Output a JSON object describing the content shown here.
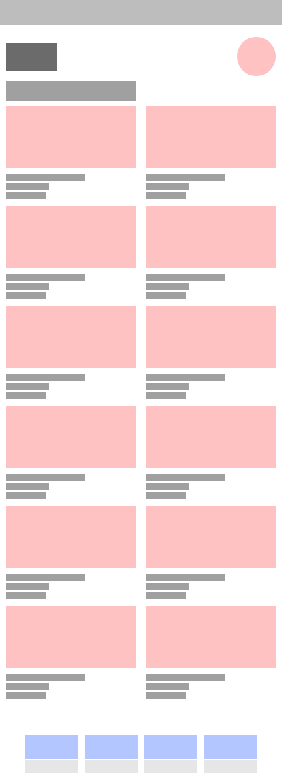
{
  "header": {
    "logo": "",
    "avatar": "",
    "section_title": ""
  },
  "cards": [
    {
      "title": "",
      "subtitle": "",
      "meta": ""
    },
    {
      "title": "",
      "subtitle": "",
      "meta": ""
    },
    {
      "title": "",
      "subtitle": "",
      "meta": ""
    },
    {
      "title": "",
      "subtitle": "",
      "meta": ""
    },
    {
      "title": "",
      "subtitle": "",
      "meta": ""
    },
    {
      "title": "",
      "subtitle": "",
      "meta": ""
    },
    {
      "title": "",
      "subtitle": "",
      "meta": ""
    },
    {
      "title": "",
      "subtitle": "",
      "meta": ""
    },
    {
      "title": "",
      "subtitle": "",
      "meta": ""
    },
    {
      "title": "",
      "subtitle": "",
      "meta": ""
    },
    {
      "title": "",
      "subtitle": "",
      "meta": ""
    },
    {
      "title": "",
      "subtitle": "",
      "meta": ""
    }
  ],
  "bottom_nav": {
    "items": [
      {
        "label": "",
        "icon": "nav-icon-1"
      },
      {
        "label": "",
        "icon": "nav-icon-2"
      },
      {
        "label": "",
        "icon": "nav-icon-3"
      },
      {
        "label": "",
        "icon": "nav-icon-4"
      }
    ]
  },
  "colors": {
    "status_bar": "#bdbdbd",
    "logo": "#6b6b6b",
    "placeholder_text": "#a0a0a0",
    "image_placeholder": "#ffc2c2",
    "nav_icon": "#b3c6ff",
    "nav_label": "#e6e6e6"
  }
}
